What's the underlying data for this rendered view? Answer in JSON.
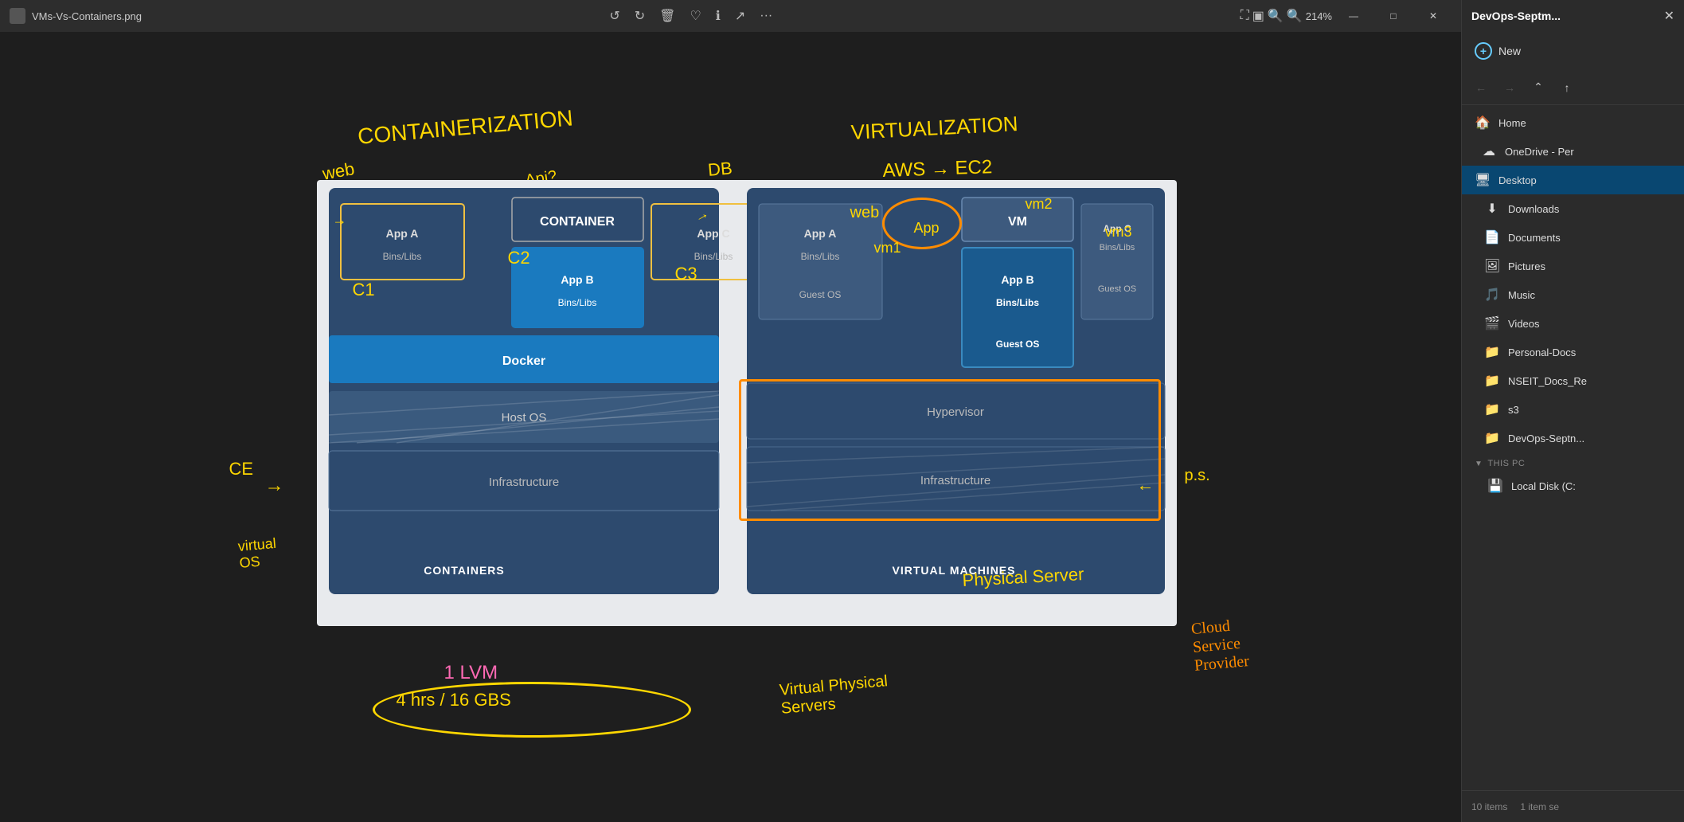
{
  "titlebar": {
    "filename": "VMs-Vs-Containers.png",
    "zoom": "214%",
    "toolbar_icons": [
      "rotate-left",
      "rotate-right",
      "delete",
      "favorite",
      "info",
      "share",
      "more"
    ]
  },
  "window_controls": {
    "minimize": "—",
    "maximize": "□",
    "close": "✕"
  },
  "diagram": {
    "containers_section": {
      "title": "CONTAINERS",
      "container_label": "CONTAINER",
      "apps": [
        {
          "name": "App A",
          "sub": "Bins/Libs",
          "highlighted": false
        },
        {
          "name": "App B",
          "sub": "Bins/Libs",
          "highlighted": true
        },
        {
          "name": "App C",
          "sub": "Bins/Libs",
          "highlighted": false
        }
      ],
      "docker_label": "Docker",
      "host_os_label": "Host OS",
      "infra_label": "Infrastructure"
    },
    "vms_section": {
      "title": "VIRTUAL MACHINES",
      "vm_label": "VM",
      "apps": [
        {
          "name": "App A",
          "sub": "Bins/Libs\nGuest OS",
          "highlighted": false
        },
        {
          "name": "App B",
          "sub": "Bins/Libs\nGuest OS",
          "highlighted": true
        },
        {
          "name": "App C",
          "sub": "Bins/Libs\nGuest OS",
          "highlighted": false
        }
      ],
      "hypervisor_label": "Hypervisor",
      "infra_label": "Infrastructure"
    }
  },
  "annotations": {
    "containerization": "CONTAINERIZATION",
    "web": "web",
    "db": "DB",
    "api": "Api?",
    "virtualization": "VIRTUALIZATION",
    "aws_ec2": "AWS → EC2",
    "c1": "C1",
    "c2": "C2",
    "c3": "C3",
    "lvm": "1 LVM",
    "hrs_gb": "4 hrs / 16 GBS",
    "virtual_physical": "Virtual Physical\nServers",
    "cloud_service": "Cloud\nService\nProvider",
    "virtual_os": "virtual\nOS",
    "ce": "CE",
    "ps": "p.s.",
    "web2": "web",
    "app2": "App",
    "vm1": "vm1",
    "vm2": "vm2",
    "vm3": "vm3"
  },
  "sidebar": {
    "header_title": "DevOps-Septm...",
    "new_label": "New",
    "nav": {
      "back": "←",
      "forward": "→",
      "up_down": "⌃",
      "up": "↑"
    },
    "items": [
      {
        "id": "home",
        "label": "Home",
        "icon": "🏠"
      },
      {
        "id": "onedrive",
        "label": "OneDrive - Per",
        "icon": "☁"
      },
      {
        "id": "desktop",
        "label": "Desktop",
        "icon": "🖥",
        "active": true
      },
      {
        "id": "downloads",
        "label": "Downloads",
        "icon": "⬇"
      },
      {
        "id": "documents",
        "label": "Documents",
        "icon": "📄"
      },
      {
        "id": "pictures",
        "label": "Pictures",
        "icon": "🖼"
      },
      {
        "id": "music",
        "label": "Music",
        "icon": "♪"
      },
      {
        "id": "videos",
        "label": "Videos",
        "icon": "▶"
      },
      {
        "id": "personal-docs",
        "label": "Personal-Docs",
        "icon": "📁"
      },
      {
        "id": "nseit-docs",
        "label": "NSEIT_Docs_Re",
        "icon": "📁"
      },
      {
        "id": "s3",
        "label": "s3",
        "icon": "📁"
      },
      {
        "id": "devops-sept",
        "label": "DevOps-Septn...",
        "icon": "📁"
      }
    ],
    "this_pc_section": "This PC",
    "local_disk_label": "Local Disk (C:",
    "status": {
      "items_count": "10 items",
      "selected": "1 item se"
    }
  }
}
